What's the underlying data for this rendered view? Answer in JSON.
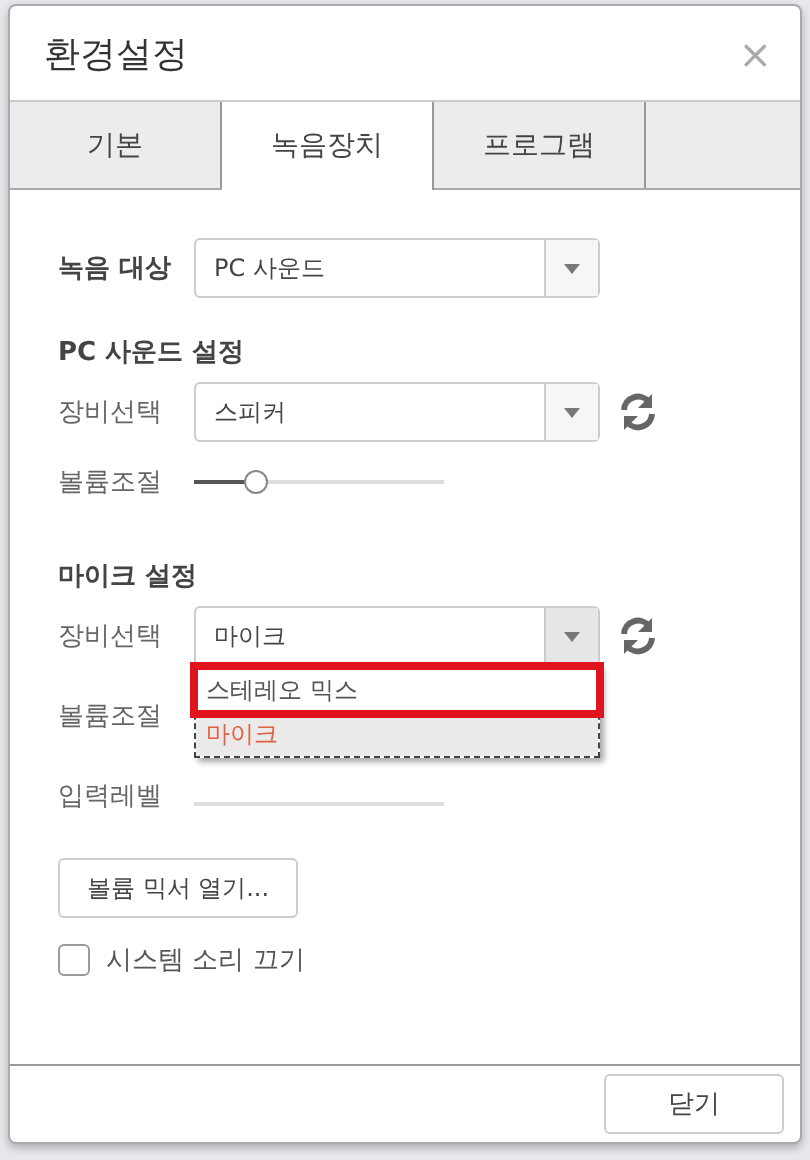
{
  "window": {
    "title": "환경설정",
    "close": "×"
  },
  "tabs": [
    {
      "label": "기본",
      "selected": false
    },
    {
      "label": "녹음장치",
      "selected": true
    },
    {
      "label": "프로그램",
      "selected": false
    }
  ],
  "record_target": {
    "label": "녹음 대상",
    "value": "PC 사운드"
  },
  "pc_sound": {
    "heading": "PC 사운드 설정",
    "device_label": "장비선택",
    "device": "스피커",
    "volume_label": "볼륨조절",
    "volume": {
      "level": 0.25
    }
  },
  "mic": {
    "heading": "마이크 설정",
    "device_label": "장비선택",
    "device": "마이크",
    "volume_label": "볼륨조절",
    "input_label": "입력레벨",
    "dropdown_options": [
      {
        "label": "스테레오 믹스",
        "selected": false,
        "annotated": true
      },
      {
        "label": "마이크",
        "selected": true,
        "annotated": false
      }
    ]
  },
  "mixer_button": "볼륨 믹서 열기...",
  "mute_system": {
    "label": "시스템 소리 끄기",
    "checked": false
  },
  "close_button": "닫기"
}
